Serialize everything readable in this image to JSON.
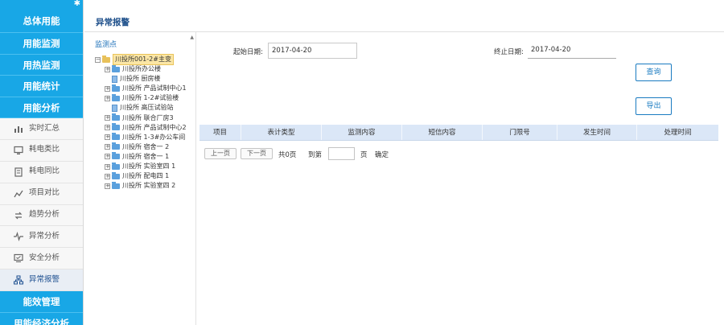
{
  "sidebar": {
    "menu_top": [
      "总体用能",
      "用能监测",
      "用热监测",
      "用能统计",
      "用能分析"
    ],
    "sub_items": [
      {
        "label": "实时汇总",
        "icon": "bar-chart-icon"
      },
      {
        "label": "耗电类比",
        "icon": "monitor-icon"
      },
      {
        "label": "耗电同比",
        "icon": "document-compare-icon"
      },
      {
        "label": "项目对比",
        "icon": "trend-icon"
      },
      {
        "label": "趋势分析",
        "icon": "refresh-arrows-icon"
      },
      {
        "label": "异常分析",
        "icon": "pulse-icon"
      },
      {
        "label": "安全分析",
        "icon": "screen-check-icon"
      },
      {
        "label": "异常报警",
        "icon": "network-icon",
        "active": true
      }
    ],
    "menu_bottom": [
      "能效管理",
      "用能经济分析"
    ]
  },
  "header": {
    "title": "异常报警"
  },
  "tree": {
    "title": "监测点",
    "root": "川投所001-2#主变",
    "nodes": [
      {
        "label": "川投所办公楼",
        "expandable": true
      },
      {
        "label": "川投所 厨房楼",
        "expandable": false
      },
      {
        "label": "川投所 产品试制中心1",
        "expandable": true
      },
      {
        "label": "川投所 1-2#试验楼",
        "expandable": true
      },
      {
        "label": "川投所 高压试验站",
        "expandable": false
      },
      {
        "label": "川投所 联合厂房3",
        "expandable": true
      },
      {
        "label": "川投所 产品试制中心2",
        "expandable": true
      },
      {
        "label": "川投所 1-3#办公车间",
        "expandable": true
      },
      {
        "label": "川投所 宿舍一 2",
        "expandable": true
      },
      {
        "label": "川投所 宿舍一 1",
        "expandable": true
      },
      {
        "label": "川投所 实验室四 1",
        "expandable": true
      },
      {
        "label": "川投所 配电四 1",
        "expandable": true
      },
      {
        "label": "川投所 实验室四 2",
        "expandable": true
      }
    ]
  },
  "form": {
    "start_label": "起始日期:",
    "start_value": "2017-04-20",
    "end_label": "终止日期:",
    "end_value": "2017-04-20",
    "query_button": "查询",
    "export_button": "导出"
  },
  "table": {
    "columns": [
      "项目",
      "表计类型",
      "监测内容",
      "短信内容",
      "门限号",
      "发生时间",
      "处理时间"
    ]
  },
  "pagination": {
    "prev": "上一页",
    "next": "下一页",
    "total_pages": "共0页",
    "goto_label": "到第",
    "page_unit": "页",
    "confirm": "确定"
  }
}
